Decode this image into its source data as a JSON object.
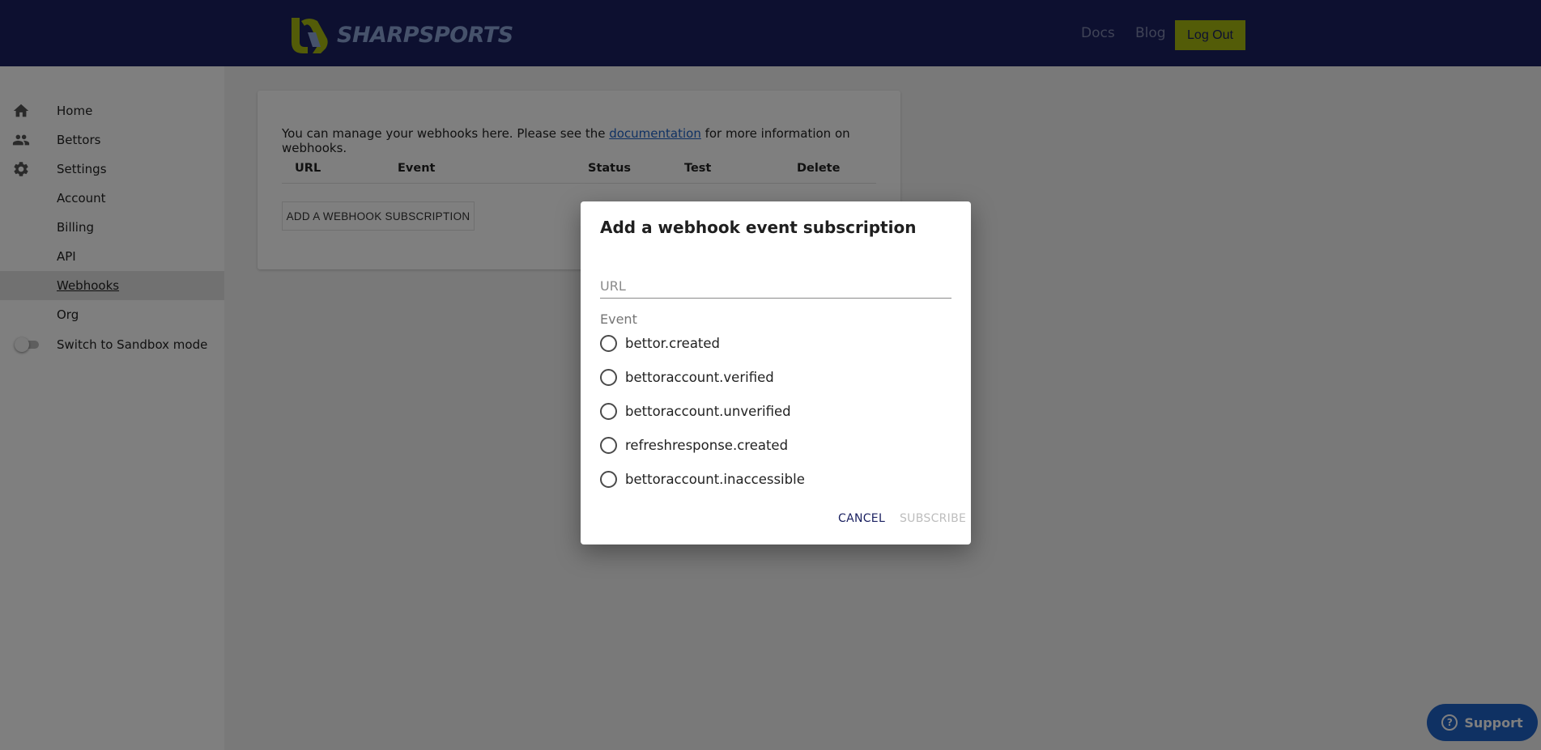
{
  "header": {
    "brand": "SHARPSPORTS",
    "nav": [
      "Docs",
      "Blog"
    ],
    "logout_label": "Log Out",
    "brand_colors": {
      "navy": "#1b2161",
      "lime": "#a6b911"
    }
  },
  "sidebar": {
    "items": [
      {
        "label": "Home",
        "icon": "home-icon"
      },
      {
        "label": "Bettors",
        "icon": "people-icon"
      },
      {
        "label": "Settings",
        "icon": "gear-icon"
      },
      {
        "label": "Account"
      },
      {
        "label": "Billing"
      },
      {
        "label": "API"
      },
      {
        "label": "Webhooks",
        "active": true
      },
      {
        "label": "Org"
      }
    ],
    "sandbox_label": "Switch to Sandbox mode"
  },
  "main": {
    "intro_before": "You can manage your webhooks here. Please see the ",
    "intro_link": "documentation",
    "intro_after": " for more information on webhooks.",
    "columns": [
      "URL",
      "Event",
      "Status",
      "Test",
      "Delete"
    ],
    "add_button": "ADD A WEBHOOK SUBSCRIPTION"
  },
  "dialog": {
    "title": "Add a webhook event subscription",
    "url_placeholder": "URL",
    "event_label": "Event",
    "events": [
      "bettor.created",
      "bettoraccount.verified",
      "bettoraccount.unverified",
      "refreshresponse.created",
      "bettoraccount.inaccessible"
    ],
    "cancel_label": "CANCEL",
    "subscribe_label": "SUBSCRIBE"
  },
  "support": {
    "label": "Support",
    "icon": "help-circle-icon"
  }
}
